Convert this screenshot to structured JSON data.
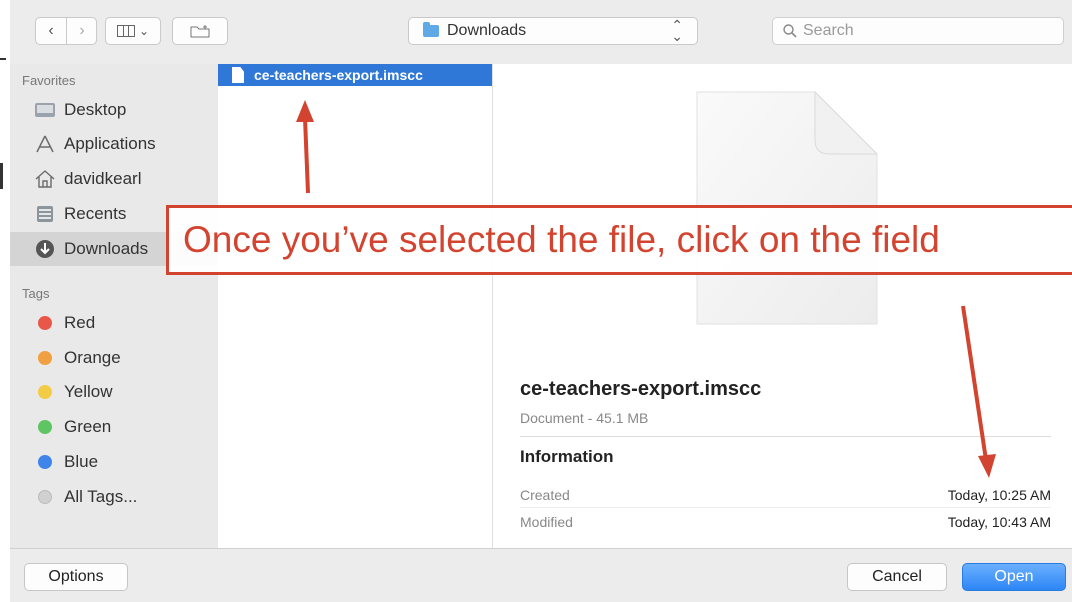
{
  "toolbar": {
    "location": "Downloads",
    "search_placeholder": "Search"
  },
  "sidebar": {
    "favorites_heading": "Favorites",
    "favorites": [
      {
        "label": "Desktop",
        "icon": "desktop-icon"
      },
      {
        "label": "Applications",
        "icon": "applications-icon"
      },
      {
        "label": "davidkearl",
        "icon": "home-icon"
      },
      {
        "label": "Recents",
        "icon": "recents-icon"
      },
      {
        "label": "Downloads",
        "icon": "downloads-icon",
        "selected": true
      }
    ],
    "tags_heading": "Tags",
    "tags": [
      {
        "label": "Red",
        "color": "#e8574a"
      },
      {
        "label": "Orange",
        "color": "#f0a040"
      },
      {
        "label": "Yellow",
        "color": "#f3cc45"
      },
      {
        "label": "Green",
        "color": "#5fc562"
      },
      {
        "label": "Blue",
        "color": "#3e84ea"
      },
      {
        "label": "All Tags...",
        "color": "#d0d0d0"
      }
    ]
  },
  "files": [
    {
      "name": "ce-teachers-export.imscc",
      "selected": true
    }
  ],
  "preview": {
    "name": "ce-teachers-export.imscc",
    "kind": "Document - 45.1 MB",
    "info_heading": "Information",
    "created_label": "Created",
    "created_value": "Today, 10:25 AM",
    "modified_label": "Modified",
    "modified_value": "Today, 10:43 AM"
  },
  "buttons": {
    "options": "Options",
    "cancel": "Cancel",
    "open": "Open"
  },
  "annotation": {
    "text": "Once you’ve selected the file, click on the field",
    "color": "#d2442f"
  }
}
